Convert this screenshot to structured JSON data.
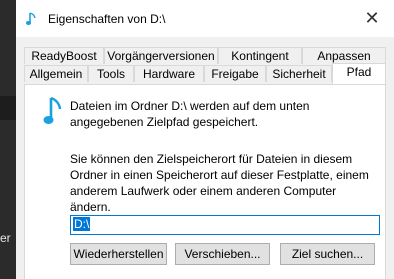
{
  "background_window": {
    "clipped_text": "er"
  },
  "window": {
    "title": "Eigenschaften von D:\\",
    "close_label": "✕"
  },
  "tabs": {
    "row1": [
      "ReadyBoost",
      "Vorgängerversionen",
      "Kontingent",
      "Anpassen"
    ],
    "row2": [
      "Allgemein",
      "Tools",
      "Hardware",
      "Freigabe",
      "Sicherheit",
      "Pfad"
    ],
    "active": "Pfad"
  },
  "panel": {
    "icon": "music-note-icon",
    "description1": "Dateien im Ordner D:\\ werden auf dem unten angegebenen Zielpfad gespeichert.",
    "description2": "Sie können den Zielspeicherort für Dateien in diesem Ordner in einen Speicherort auf dieser Festplatte, einem anderem Laufwerk oder einem anderen Computer ändern.",
    "path_value": "D:\\",
    "buttons": {
      "restore": "Wiederherstellen",
      "move": "Verschieben...",
      "find_target": "Ziel suchen..."
    }
  },
  "colors": {
    "accent": "#0078d7",
    "icon_teal": "#1ba1e2"
  }
}
